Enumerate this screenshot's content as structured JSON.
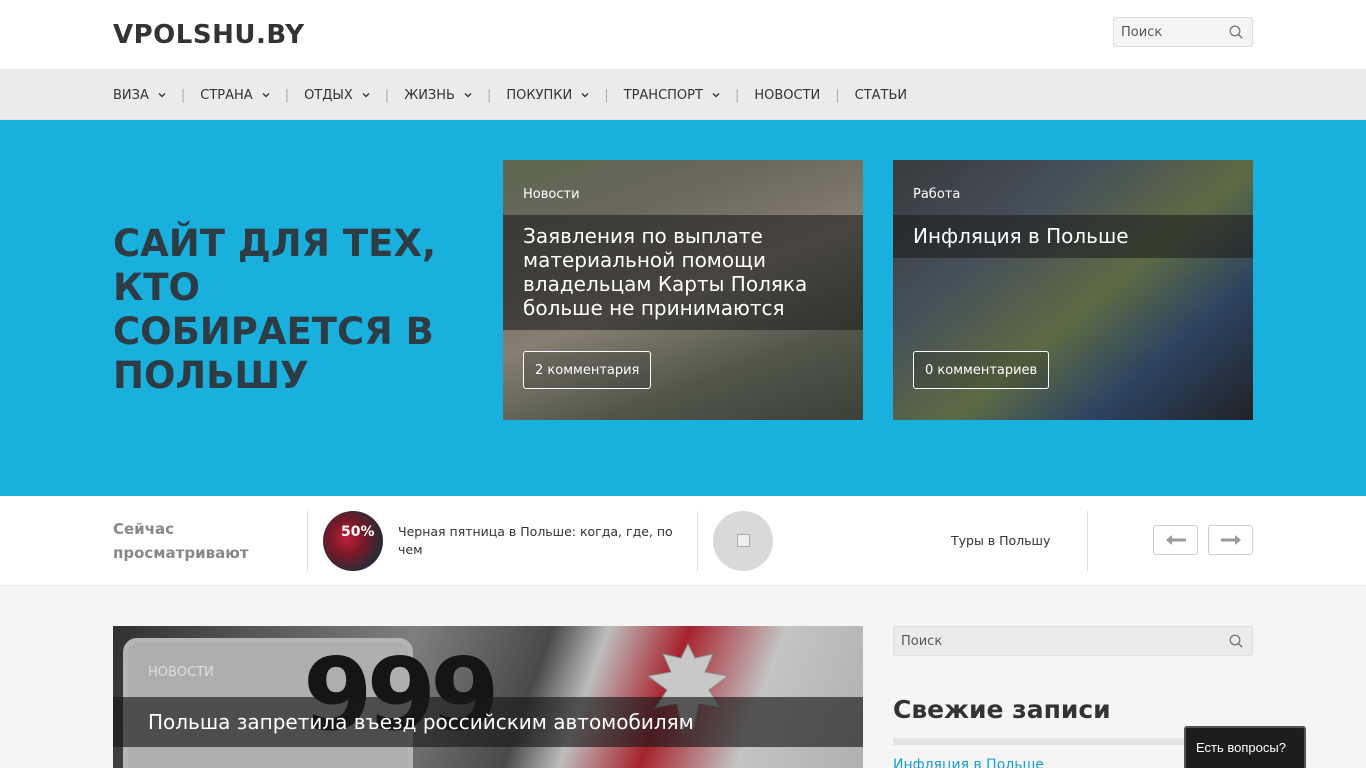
{
  "header": {
    "logo": "VPOLSHU.BY",
    "search_placeholder": "Поиск"
  },
  "nav": {
    "items": [
      {
        "label": "ВИЗА",
        "has_dropdown": true
      },
      {
        "label": "СТРАНА",
        "has_dropdown": true
      },
      {
        "label": "ОТДЫХ",
        "has_dropdown": true
      },
      {
        "label": "ЖИЗНЬ",
        "has_dropdown": true
      },
      {
        "label": "ПОКУПКИ",
        "has_dropdown": true
      },
      {
        "label": "ТРАНСПОРТ",
        "has_dropdown": true
      },
      {
        "label": "НОВОСТИ",
        "has_dropdown": false
      },
      {
        "label": "СТАТЬИ",
        "has_dropdown": false
      }
    ]
  },
  "hero": {
    "title": "САЙТ ДЛЯ ТЕХ, КТО СОБИРАЕТСЯ В ПОЛЬШУ",
    "cards": [
      {
        "category": "Новости",
        "title": "Заявления по выплате материальной помощи владельцам Карты Поляка больше не принимаются",
        "comments": "2 комментария"
      },
      {
        "category": "Работа",
        "title": "Инфляция в Польше",
        "comments": "0 комментариев"
      }
    ]
  },
  "trending": {
    "label": "Сейчас просматривают",
    "items": [
      {
        "title": "Черная пятница в Польше: когда, где, по чем",
        "thumb_text": "50%"
      },
      {
        "title": "Туры в Польшу"
      }
    ]
  },
  "main_post": {
    "category": "НОВОСТИ",
    "title": "Польша запретила въезд российским автомобилям",
    "plate_text": "999"
  },
  "sidebar": {
    "search_placeholder": "Поиск",
    "recent_title": "Свежие записи",
    "recent_first": "Инфляция в Польше"
  },
  "chat": {
    "label": "Есть вопросы?"
  },
  "colors": {
    "hero_bg": "#1ab0de",
    "link": "#1a9ed0"
  }
}
